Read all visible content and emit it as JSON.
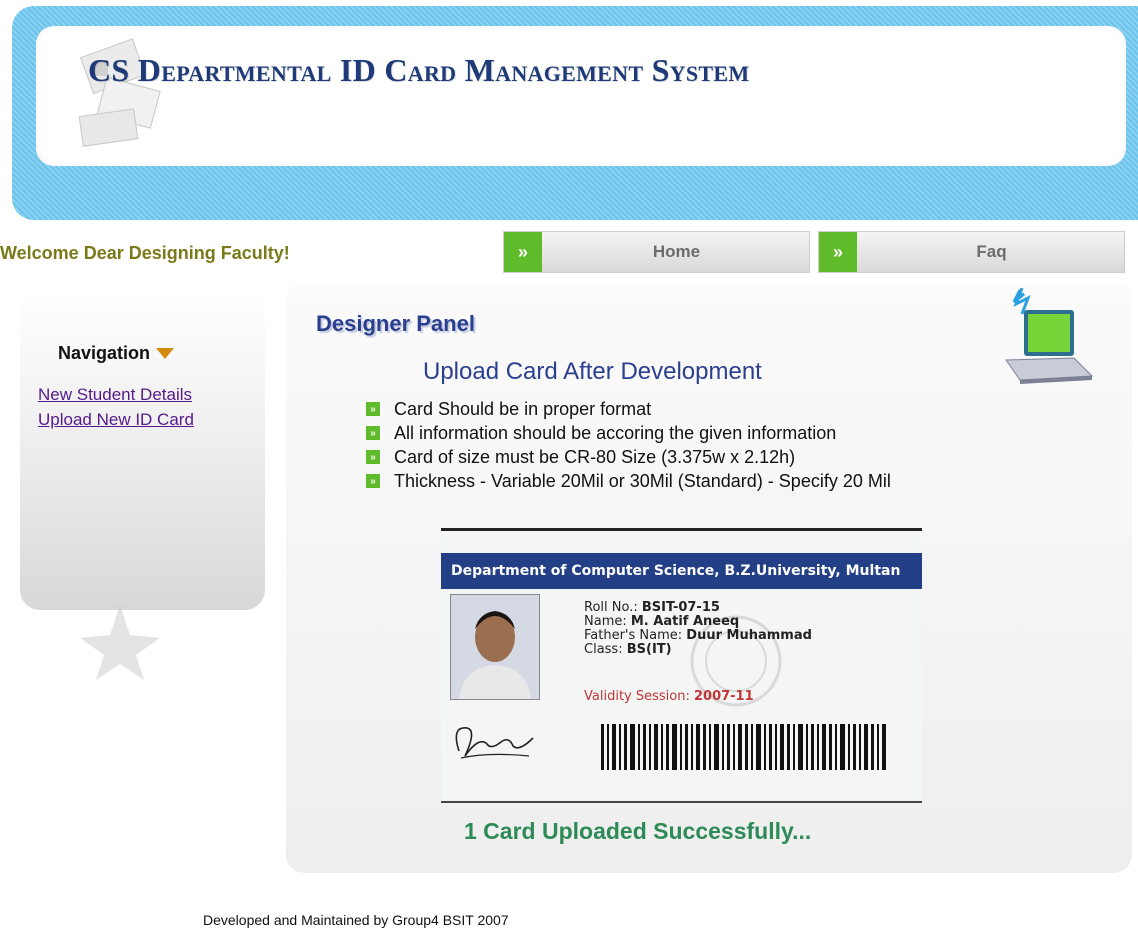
{
  "header": {
    "title": "CS Departmental ID Card Management System"
  },
  "welcome_text": "Welcome Dear Designing Faculty!",
  "top_nav": [
    {
      "label": "Home",
      "arrow": "»"
    },
    {
      "label": "Faq",
      "arrow": "»"
    }
  ],
  "sidebar": {
    "heading": "Navigation",
    "links": [
      "New Student Details",
      "Upload New ID Card"
    ]
  },
  "main": {
    "panel_title": "Designer Panel",
    "upload_heading": "Upload Card After Development",
    "rules": [
      "Card Should be in proper format",
      "All information should be accoring the given information",
      "Card of size must be CR-80 Size (3.375w x 2.12h)",
      "Thickness - Variable 20Mil or 30Mil (Standard) - Specify 20 Mil"
    ],
    "bullet_glyph": "»",
    "status_message": "1 Card Uploaded Successfully..."
  },
  "id_card": {
    "header": "Department of Computer Science, B.Z.University, Multan",
    "roll_label": "Roll No.:",
    "roll_value": "BSIT-07-15",
    "name_label": "Name:",
    "name_value": "M. Aatif Aneeq",
    "father_label": "Father's Name:",
    "father_value": "Duur Muhammad",
    "class_label": "Class:",
    "class_value": "BS(IT)",
    "validity_label": "Validity Session:",
    "validity_value": "2007-11"
  },
  "footer": "Developed and Maintained by Group4 BSIT 2007",
  "colors": {
    "header_blue": "#6cc2ea",
    "title_navy": "#1e3a78",
    "accent_green": "#5fbb2a",
    "link_purple": "#55198b",
    "success_green": "#2e8b57"
  }
}
